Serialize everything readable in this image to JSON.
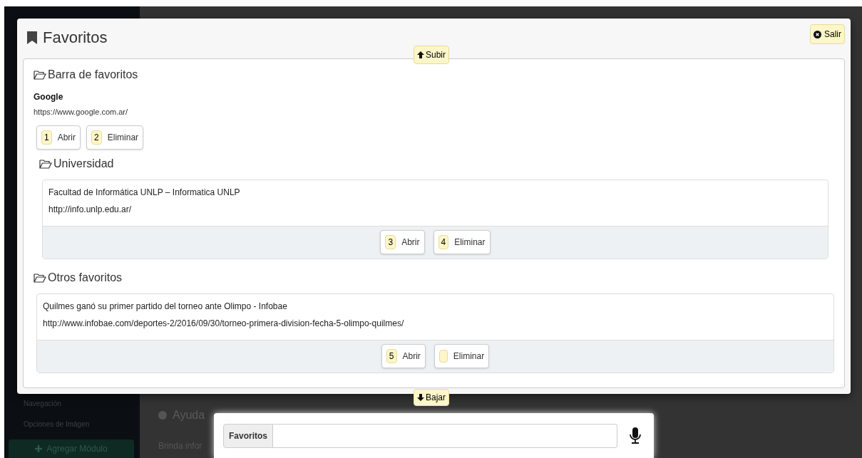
{
  "background_page": {
    "sidebar_items": [
      "Navegación",
      "Opciones de Imágen"
    ],
    "add_button": "Agregar Módulo",
    "section_title": "Ayuda",
    "section_text": "Brinda infor"
  },
  "modal": {
    "title": "Favoritos",
    "close_button": "Salir",
    "scroll_up": "Subir",
    "scroll_down": "Bajar",
    "folders": [
      {
        "name": "Barra de favoritos",
        "kind": "plain",
        "bookmarks": [
          {
            "title": "Google",
            "url": "https://www.google.com.ar/",
            "buttons": [
              {
                "number": "1",
                "label": "Abrir"
              },
              {
                "number": "2",
                "label": "Eliminar"
              }
            ]
          }
        ],
        "children": [
          {
            "name": "Universidad",
            "kind": "card",
            "bookmarks": [
              {
                "title": "Facultad de Informática UNLP – Informatica UNLP",
                "url": "http://info.unlp.edu.ar/",
                "buttons": [
                  {
                    "number": "3",
                    "label": "Abrir"
                  },
                  {
                    "number": "4",
                    "label": "Eliminar"
                  }
                ]
              }
            ]
          }
        ]
      },
      {
        "name": "Otros favoritos",
        "kind": "card",
        "bookmarks": [
          {
            "title": "Quilmes ganó su primer partido del torneo ante Olimpo - Infobae",
            "url": "http://www.infobae.com/deportes-2/2016/09/30/torneo-primera-division-fecha-5-olimpo-quilmes/",
            "buttons": [
              {
                "number": "5",
                "label": "Abrir"
              },
              {
                "label": "Eliminar"
              }
            ]
          }
        ]
      }
    ]
  },
  "voice_bar": {
    "label": "Favoritos"
  }
}
